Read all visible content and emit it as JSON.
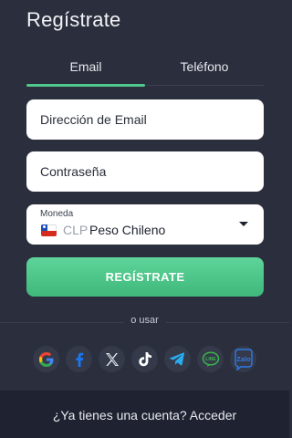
{
  "title": "Regístrate",
  "tabs": [
    {
      "label": "Email",
      "active": true
    },
    {
      "label": "Teléfono",
      "active": false
    }
  ],
  "email_field": {
    "placeholder": "Dirección de Email",
    "value": ""
  },
  "password_field": {
    "placeholder": "Contraseña",
    "value": ""
  },
  "currency_select": {
    "label": "Moneda",
    "flag_icon": "chile-flag-icon",
    "code": "CLP",
    "name": "Peso Chileno"
  },
  "submit_label": "REGÍSTRATE",
  "divider_text": "o usar",
  "social_providers": [
    {
      "name": "google-icon"
    },
    {
      "name": "facebook-icon"
    },
    {
      "name": "x-icon"
    },
    {
      "name": "tiktok-icon"
    },
    {
      "name": "telegram-icon"
    },
    {
      "name": "line-icon"
    },
    {
      "name": "zalo-icon"
    }
  ],
  "footer": {
    "question": "¿Ya tienes una cuenta?",
    "link_label": "Acceder"
  },
  "colors": {
    "background": "#2a2e3d",
    "accent": "#4fc98b",
    "footer_bg": "#1f2231"
  }
}
